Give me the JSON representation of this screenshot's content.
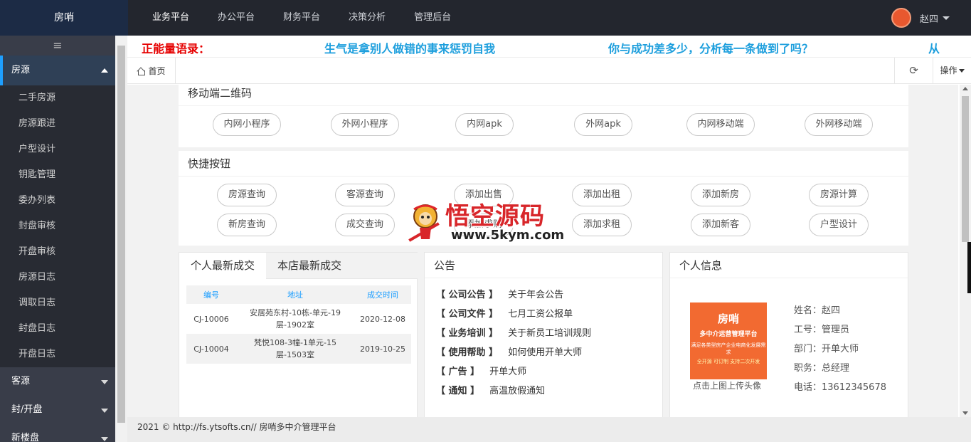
{
  "header": {
    "logo": "房哨",
    "nav": [
      "业务平台",
      "办公平台",
      "财务平台",
      "决策分析",
      "管理后台"
    ],
    "active_nav": "业务平台",
    "user": "赵四"
  },
  "sidebar": {
    "toggle": "≡",
    "groups": [
      {
        "label": "房源",
        "items": [
          "二手房源",
          "房源跟进",
          "户型设计",
          "钥匙管理",
          "委办列表",
          "封盘审核",
          "开盘审核",
          "房源日志",
          "调取日志",
          "封盘日志",
          "开盘日志"
        ]
      },
      {
        "label": "客源"
      },
      {
        "label": "封/开盘"
      },
      {
        "label": "新楼盘"
      }
    ]
  },
  "marquee": {
    "label": "正能量语录：",
    "quotes": [
      "生气是拿别人做错的事来惩罚自我",
      "你与成功差多少，分析每一条做到了吗？",
      "从"
    ]
  },
  "tabs": {
    "home": "首页",
    "refresh": "⟳",
    "ops": "操作"
  },
  "qr_section": {
    "title": "移动端二维码",
    "buttons": [
      "内网小程序",
      "外网小程序",
      "内网apk",
      "外网apk",
      "内网移动端",
      "外网移动端"
    ]
  },
  "quick_section": {
    "title": "快捷按钮",
    "row1": [
      "房源查询",
      "客源查询",
      "添加出售",
      "添加出租",
      "添加新房",
      "房源计算"
    ],
    "row2": [
      "新房查询",
      "成交查询",
      "添加求购",
      "添加求租",
      "添加新客",
      "户型设计"
    ]
  },
  "deals": {
    "tabs": [
      "个人最新成交",
      "本店最新成交"
    ],
    "columns": [
      "编号",
      "地址",
      "成交时间"
    ],
    "rows": [
      {
        "id": "CJ-10006",
        "addr1": "安居苑东村-10栋-单元-19",
        "addr2": "层-1902室",
        "date": "2020-12-08"
      },
      {
        "id": "CJ-10004",
        "addr1": "梵悦108-3幢-1单元-15",
        "addr2": "层-1503室",
        "date": "2019-10-25"
      }
    ]
  },
  "notice": {
    "title": "公告",
    "items": [
      {
        "tag": "【 公司公告 】",
        "text": "关于年会公告"
      },
      {
        "tag": "【 公司文件 】",
        "text": "七月工资公报单"
      },
      {
        "tag": "【 业务培训 】",
        "text": "关于新员工培训规则"
      },
      {
        "tag": "【 使用帮助 】",
        "text": "如何使用开单大师"
      },
      {
        "tag": "【 广告 】",
        "text": "开单大师"
      },
      {
        "tag": "【 通知 】",
        "text": "高温放假通知"
      }
    ]
  },
  "profile": {
    "title": "个人信息",
    "promo": {
      "line1": "房哨",
      "line2": "多中介运营管理平台",
      "line3": "满足各类型房产企业电商化发展需求",
      "line4": "全开源 可订制 支持二次开发"
    },
    "upload_hint": "点击上图上传头像",
    "fields": [
      {
        "label": "姓名：",
        "value": "赵四"
      },
      {
        "label": "工号：",
        "value": "管理员"
      },
      {
        "label": "部门：",
        "value": "开单大师"
      },
      {
        "label": "职务：",
        "value": "总经理"
      },
      {
        "label": "电话：",
        "value": "13612345678"
      }
    ]
  },
  "watermark": {
    "text": "悟空源码",
    "url": "www.5kym.com"
  },
  "footer": {
    "text": "2021 © http://fs.ytsofts.cn// 房哨多中介管理平台"
  },
  "colors": {
    "header_bg": "#23262e",
    "sidebar_bg": "#393d49",
    "accent": "#1e9fff",
    "marquee_label": "#e60000",
    "marquee_text": "#1e9fdd",
    "promo_bg": "#f26a31"
  }
}
